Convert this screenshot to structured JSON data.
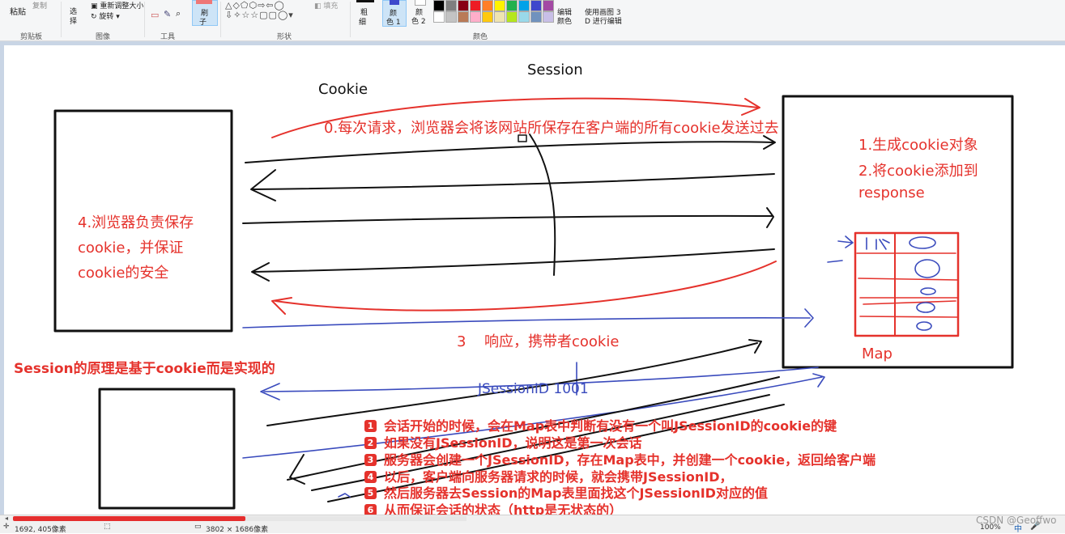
{
  "ribbon": {
    "clipboard": {
      "paste": "粘贴",
      "copy": "复制",
      "group": "剪贴板"
    },
    "image": {
      "select": "选",
      "select2": "择",
      "resize": "重新调整大小",
      "rotate": "旋转",
      "group": "图像"
    },
    "tools": {
      "group": "工具"
    },
    "brushes": {
      "label": "刷",
      "label2": "子"
    },
    "shapes": {
      "fill": "填充",
      "group": "形状"
    },
    "size": {
      "label": "粗",
      "label2": "细"
    },
    "color1": {
      "label": "颜",
      "label2": "色 1"
    },
    "color2": {
      "label": "颜",
      "label2": "色 2"
    },
    "colors": {
      "group": "颜色"
    },
    "edit_colors": {
      "line1": "编辑",
      "line2": "颜色"
    },
    "paint3d": {
      "line1": "使用画图 3",
      "line2": "D 进行编辑"
    },
    "palette": [
      "#000000",
      "#7f7f7f",
      "#880015",
      "#ed1c24",
      "#ff7f27",
      "#fff200",
      "#22b14c",
      "#00a2e8",
      "#3f48cc",
      "#a349a4",
      "#ffffff",
      "#c3c3c3",
      "#b97a57",
      "#ffaec9",
      "#ffc90e",
      "#efe4b0",
      "#b5e61d",
      "#99d9ea",
      "#7092be",
      "#c8bfe7"
    ]
  },
  "diagram": {
    "session_label": "Session",
    "cookie_label": "Cookie",
    "request_note": "0.每次请求，浏览器会将该网站所保存在客户端的所有cookie发送过去",
    "server_note1": "1.生成cookie对象",
    "server_note2": "2.将cookie添加到",
    "server_note3": "response",
    "browser_note1": "4.浏览器负责保存",
    "browser_note2": "cookie，并保证",
    "browser_note3": "cookie的安全",
    "response_num": "3",
    "response_note": "响应，携带者cookie",
    "map_label": "Map",
    "session_principle": "Session的原理是基于cookie而是实现的",
    "jsessionid": "JSessionID   1001"
  },
  "steps": [
    {
      "num": "1",
      "text": "会话开始的时候，会在Map表中判断有没有一个叫JSessionID的cookie的键"
    },
    {
      "num": "2",
      "text": "如果没有JSessionID，说明这是第一次会话"
    },
    {
      "num": "3",
      "text": "服务器会创建一个JSessionID，存在Map表中，并创建一个cookie，返回给客户端"
    },
    {
      "num": "4",
      "text": "以后，客户端向服务器请求的时候，就会携带JSessionID，"
    },
    {
      "num": "5",
      "text": "然后服务器去Session的Map表里面找这个JSessionID对应的值"
    },
    {
      "num": "6",
      "text": "从而保证会话的状态（http是无状态的）"
    }
  ],
  "status": {
    "cursor_pos": "1692, 405像素",
    "image_size": "3802 × 1686像素",
    "zoom": "100%",
    "watermark": "CSDN @Geoffwo",
    "tray": "中"
  },
  "colors": {
    "red": "#e5322c",
    "blue": "#3a4bbd",
    "black": "#111111"
  }
}
